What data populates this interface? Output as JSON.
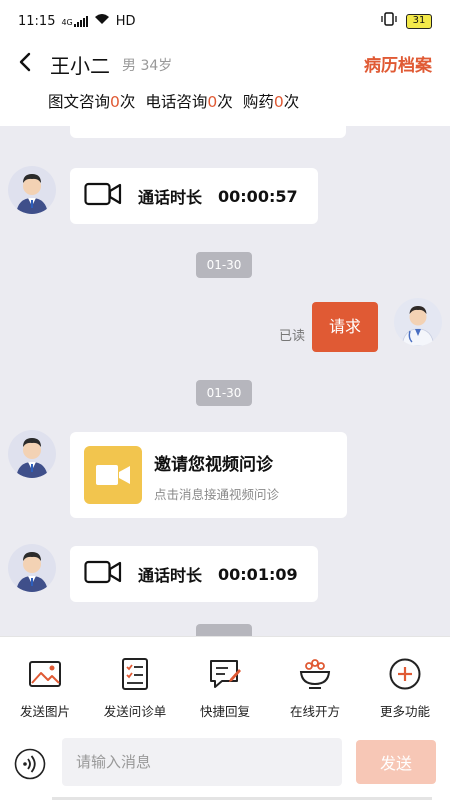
{
  "status_bar": {
    "time": "11:15",
    "network": "4G",
    "hd": "HD",
    "battery": "31"
  },
  "header": {
    "patient_name": "王小二",
    "patient_meta": "男 34岁",
    "records_link": "病历档案",
    "stats": [
      {
        "label": "图文咨询",
        "count": "0",
        "unit": "次"
      },
      {
        "label": "电话咨询",
        "count": "0",
        "unit": "次"
      },
      {
        "label": "购药",
        "count": "0",
        "unit": "次"
      }
    ]
  },
  "chat": {
    "messages": [
      {
        "type": "call",
        "label": "通话时长",
        "duration": "00:00:57"
      },
      {
        "type": "date",
        "text": "01-30"
      },
      {
        "type": "request",
        "read": "已读",
        "text": "请求"
      },
      {
        "type": "date",
        "text": "01-30"
      },
      {
        "type": "invite",
        "title": "邀请您视频问诊",
        "subtitle": "点击消息接通视频问诊"
      },
      {
        "type": "call",
        "label": "通话时长",
        "duration": "00:01:09"
      }
    ]
  },
  "toolbar": {
    "items": [
      {
        "label": "发送图片",
        "icon": "image-icon"
      },
      {
        "label": "发送问诊单",
        "icon": "form-icon"
      },
      {
        "label": "快捷回复",
        "icon": "quick-reply-icon"
      },
      {
        "label": "在线开方",
        "icon": "prescription-bowl-icon"
      },
      {
        "label": "更多功能",
        "icon": "plus-circle-icon"
      }
    ]
  },
  "input_bar": {
    "placeholder": "请输入消息",
    "send_label": "发送"
  },
  "colors": {
    "accent": "#e05a34",
    "chat_bg": "#ebebf1",
    "send_disabled": "#f7c7b6"
  }
}
